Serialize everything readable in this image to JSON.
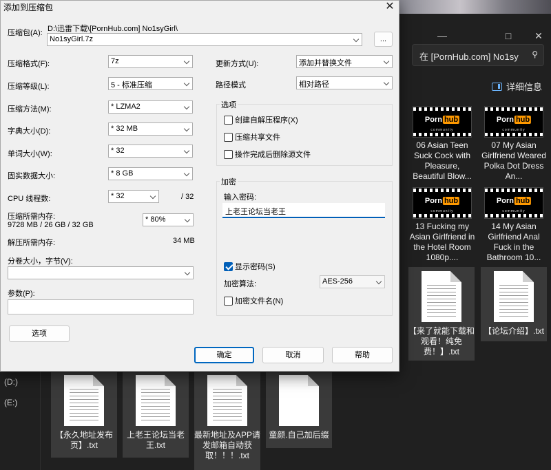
{
  "explorer": {
    "search_text": "在 [PornHub.com] No1sy",
    "details_label": "详细信息",
    "window_controls": [
      "—",
      "□",
      "✕"
    ],
    "drives": [
      "(D:)",
      "(E:)"
    ],
    "files": [
      {
        "name": "06 Asian Teen Suck Cock with Pleasure, Beautiful Blow...",
        "type": "video",
        "brand": "Porn",
        "brand_accent": "hub",
        "brand_sub": "community"
      },
      {
        "name": "07 My Asian Girlfriend Weared Polka Dot Dress An...",
        "type": "video",
        "brand": "Porn",
        "brand_accent": "hub",
        "brand_sub": "community"
      },
      {
        "name": "13 Fucking my Asian Girlfriend in the Hotel Room 1080p....",
        "type": "video",
        "brand": "Porn",
        "brand_accent": "hub",
        "brand_sub": "community"
      },
      {
        "name": "14 My Asian Girlfriend Anal Fuck in the Bathroom 10...",
        "type": "video",
        "brand": "Porn",
        "brand_accent": "hub",
        "brand_sub": "community"
      },
      {
        "name": "【来了就能下载和观看！纯免费！】.txt",
        "type": "txt"
      },
      {
        "name": "【论坛介绍】.txt",
        "type": "txt"
      },
      {
        "name": "【永久地址发布页】.txt",
        "type": "txt"
      },
      {
        "name": "上老王论坛当老王.txt",
        "type": "txt"
      },
      {
        "name": "最新地址及APP请发邮箱自动获取！！！.txt",
        "type": "txt"
      },
      {
        "name": "童颜.自己加后缀",
        "type": "blank"
      }
    ]
  },
  "dialog": {
    "title": "添加到压缩包",
    "archive_label": "压缩包(A):",
    "archive_path": "D:\\迅雷下载\\[PornHub.com] No1syGirl\\",
    "archive_name": "No1syGirl.7z",
    "browse_label": "...",
    "format_label": "压缩格式(F):",
    "format_value": "7z",
    "level_label": "压缩等级(L):",
    "level_value": "5 - 标准压缩",
    "method_label": "压缩方法(M):",
    "method_value": "*  LZMA2",
    "dict_label": "字典大小(D):",
    "dict_value": "*  32 MB",
    "word_label": "单词大小(W):",
    "word_value": "*  32",
    "solid_label": "固实数据大小:",
    "solid_value": "*  8 GB",
    "threads_label": "CPU 线程数:",
    "threads_value": "*  32",
    "threads_total": "/ 32",
    "mem_label": "压缩所需内存:",
    "mem_detail": "9728 MB / 26 GB / 32 GB",
    "mem_value": "*  80%",
    "decomp_label": "解压所需内存:",
    "decomp_value": "34 MB",
    "volume_label": "分卷大小，字节(V):",
    "volume_value": "",
    "params_label": "参数(P):",
    "params_value": "",
    "options_button": "选项",
    "update_label": "更新方式(U):",
    "update_value": "添加并替换文件",
    "path_label": "路径模式",
    "path_value": "相对路径",
    "options_group": "选项",
    "opt_sfx": "创建自解压程序(X)",
    "opt_shared": "压缩共享文件",
    "opt_delete": "操作完成后删除源文件",
    "encrypt_group": "加密",
    "password_label": "输入密码:",
    "password_value": "上老王论坛当老王",
    "show_password": "显示密码(S)",
    "show_password_checked": true,
    "enc_method_label": "加密算法:",
    "enc_method_value": "AES-256",
    "enc_names": "加密文件名(N)",
    "ok_button": "确定",
    "cancel_button": "取消",
    "help_button": "帮助"
  }
}
